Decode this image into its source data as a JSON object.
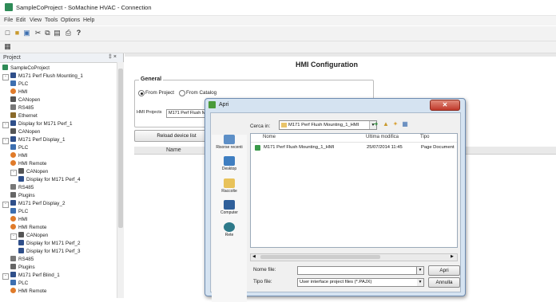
{
  "window": {
    "title": "SampleCoProject - SoMachine HVAC - Connection"
  },
  "menu": [
    "File",
    "Edit",
    "View",
    "Tools",
    "Options",
    "Help"
  ],
  "project_panel": {
    "header": "Project",
    "pin": "‡ ×",
    "tree": [
      {
        "label": "SampleCoProject",
        "level": 0,
        "icon": "project",
        "exp": ""
      },
      {
        "label": "M171 Perf Flush Mounting_1",
        "level": 0,
        "icon": "controller",
        "exp": "-"
      },
      {
        "label": "PLC",
        "level": 1,
        "icon": "plc",
        "exp": ""
      },
      {
        "label": "HMI",
        "level": 1,
        "icon": "hmi",
        "exp": ""
      },
      {
        "label": "CANopen",
        "level": 1,
        "icon": "canopen",
        "exp": ""
      },
      {
        "label": "RS485",
        "level": 1,
        "icon": "rs485",
        "exp": ""
      },
      {
        "label": "Ethernet",
        "level": 1,
        "icon": "ethernet",
        "exp": ""
      },
      {
        "label": "Display for M171 Perf_1",
        "level": 0,
        "icon": "display",
        "exp": "-"
      },
      {
        "label": "CANopen",
        "level": 1,
        "icon": "canopen",
        "exp": ""
      },
      {
        "label": "M171 Perf Display_1",
        "level": 0,
        "icon": "controller",
        "exp": "-"
      },
      {
        "label": "PLC",
        "level": 1,
        "icon": "plc",
        "exp": ""
      },
      {
        "label": "HMI",
        "level": 1,
        "icon": "hmi",
        "exp": ""
      },
      {
        "label": "HMI Remote",
        "level": 1,
        "icon": "hmi",
        "exp": ""
      },
      {
        "label": "CANopen",
        "level": 1,
        "icon": "canopen",
        "exp": "-"
      },
      {
        "label": "Display for M171 Perf_4",
        "level": 2,
        "icon": "display",
        "exp": ""
      },
      {
        "label": "RS485",
        "level": 1,
        "icon": "rs485",
        "exp": ""
      },
      {
        "label": "Plugins",
        "level": 1,
        "icon": "plugins",
        "exp": ""
      },
      {
        "label": "M171 Perf Display_2",
        "level": 0,
        "icon": "controller",
        "exp": "-"
      },
      {
        "label": "PLC",
        "level": 1,
        "icon": "plc",
        "exp": ""
      },
      {
        "label": "HMI",
        "level": 1,
        "icon": "hmi",
        "exp": ""
      },
      {
        "label": "HMI Remote",
        "level": 1,
        "icon": "hmi",
        "exp": ""
      },
      {
        "label": "CANopen",
        "level": 1,
        "icon": "canopen",
        "exp": "-"
      },
      {
        "label": "Display for M171 Perf_2",
        "level": 2,
        "icon": "display",
        "exp": ""
      },
      {
        "label": "Display for M171 Perf_3",
        "level": 2,
        "icon": "display",
        "exp": ""
      },
      {
        "label": "RS485",
        "level": 1,
        "icon": "rs485",
        "exp": ""
      },
      {
        "label": "Plugins",
        "level": 1,
        "icon": "plugins",
        "exp": ""
      },
      {
        "label": "M171 Perf Blind_1",
        "level": 0,
        "icon": "controller",
        "exp": "-"
      },
      {
        "label": "PLC",
        "level": 1,
        "icon": "plc",
        "exp": ""
      },
      {
        "label": "HMI Remote",
        "level": 1,
        "icon": "hmi",
        "exp": ""
      }
    ]
  },
  "editor": {
    "title": "HMI Configuration",
    "general_legend": "General",
    "from_project_label": "From Project",
    "from_catalog_label": "From Catalog",
    "hmi_projects_label": "HMI Projects",
    "hmi_projects_value": "M171 Perf Flush Mounting_1_HMI",
    "reload_button": "Reload device list",
    "grid_name_header": "Name"
  },
  "dialog": {
    "title": "Apri",
    "close_glyph": "✕",
    "look_in_label": "Cerca in:",
    "look_in_value": "M171 Perf Flush Mounting_1_HMI",
    "places": [
      "Risorse recenti",
      "Desktop",
      "Raccolte",
      "Computer",
      "Rete"
    ],
    "columns": {
      "name": "Nome",
      "modified": "Ultima modifica",
      "type": "Tipo"
    },
    "file": {
      "name": "M171 Perf Flush Mounting_1_HMI",
      "modified": "25/07/2014 11:45",
      "type": "Page Document"
    },
    "file_name_label": "Nome file:",
    "file_name_value": "",
    "file_type_label": "Tipo file:",
    "file_type_value": "User interface project files (*.PAJX)",
    "open_button": "Apri",
    "cancel_button": "Annulla"
  },
  "colors": {
    "accent_blue": "#1f5fa8",
    "dialog_frame": "#d5e3f1",
    "close_red": "#c0392b",
    "project_green": "#2e8b57"
  }
}
